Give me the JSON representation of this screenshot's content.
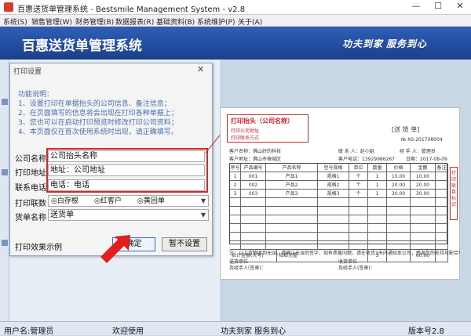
{
  "window": {
    "title": "百惠送货单管理系统 - Bestsmile Management System - v2.8"
  },
  "menu": [
    "系统(S)",
    "销售管理(W)",
    "财务管理(B)",
    "数据报表(R)",
    "基础资料(B)",
    "系统维护(P)",
    "关于(A)"
  ],
  "banner": {
    "title": "百惠送货单管理系统",
    "slogan": "功夫到家 服务到心"
  },
  "dialog": {
    "title": "打印设置",
    "tips_heading": "功能说明：",
    "tips": [
      "1、设置打印在单据抬头的公司信息、备注信息；",
      "2、在页面填写的信息将会出现在打印各种单据上；",
      "3、您也可以在启动打印预览时修改打印公司资料；",
      "4、本页面仅在首次使用系统时出现，请正确填写。"
    ],
    "fields": {
      "company_label": "公司名称",
      "company_value": "公司抬头名称",
      "address_label": "打印地址",
      "address_value": "地址：公司地址",
      "phone_label": "联系电话",
      "phone_value": "电话：电话"
    },
    "copies_label": "打印联数",
    "copies_options": [
      "◎白存根",
      "◎红客户",
      "◎黄回单"
    ],
    "doc_label": "货单名称",
    "doc_value": "送货单",
    "preview_label": "打印效果示例",
    "ok_label": "确定",
    "nosetup_label": "暂不设置"
  },
  "preview": {
    "header_title": "打印抬头（公司名称）",
    "header_line1": "打印公司地址",
    "header_line2": "打印联系方式",
    "doc_title": "[送 货 单]",
    "doc_no": "№ XS-201708004",
    "customer": "客户名称：佛山好的科技",
    "contact": "联 系 人：赵小姐",
    "handler": "经 手 人：管理员",
    "cust_addr": "客户地址：佛山市禅城区",
    "cust_phone": "客户电话：13929986267",
    "date": "日期：2017-08-09",
    "columns": [
      "序号",
      "产品编号",
      "产品名称",
      "型号规格",
      "单位",
      "数量",
      "价格",
      "金额",
      "备注"
    ],
    "rows": [
      [
        "1",
        "001",
        "产品1",
        "规格1",
        "个",
        "1",
        "10.00",
        "10.00",
        ""
      ],
      [
        "2",
        "002",
        "产品2",
        "规格2",
        "个",
        "1",
        "20.00",
        "20.00",
        ""
      ],
      [
        "3",
        "003",
        "产品3",
        "规格3",
        "个",
        "1",
        "30.00",
        "30.00",
        ""
      ]
    ],
    "total_label": "合计金额(大写)",
    "total_words": "陆拾元整",
    "total_qty": "3",
    "total_amount": "60.00",
    "note": "注：以上货物收到无误，请确认无误后签字，如有质量问题，请在收货3天内通知本公司，感谢您的支持与配合！",
    "sign_left1": "送货单位",
    "sign_left2": "及经手人(签章)：",
    "sign_right1": "收货单位",
    "sign_right2": "及经手人(签章)：",
    "side_label": "打印联数标识"
  },
  "statusbar": {
    "user": "用户名:管理员",
    "welcome": "欢迎使用",
    "slogan": "功夫到家 服务到心",
    "version": "版本号2.8"
  },
  "colors": {
    "banner": "#1b3f8c",
    "highlight": "#d2282e",
    "accent_text": "#4a6fb0"
  }
}
